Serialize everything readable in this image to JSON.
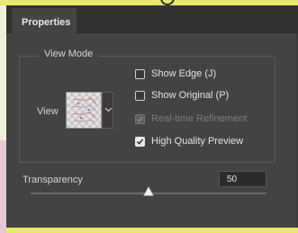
{
  "panel": {
    "tab_label": "Properties"
  },
  "view_mode": {
    "group_title": "View Mode",
    "view_label": "View",
    "options": [
      {
        "label": "Show Edge (J)",
        "checked": false,
        "disabled": false
      },
      {
        "label": "Show Original (P)",
        "checked": false,
        "disabled": false
      },
      {
        "label": "Real-time Refinement",
        "checked": true,
        "disabled": true
      },
      {
        "label": "High Quality Preview",
        "checked": true,
        "disabled": false
      }
    ]
  },
  "transparency": {
    "label": "Transparency",
    "value": "50",
    "slider_fraction": 0.5
  },
  "icons": {
    "dropdown": "chevron-down-icon",
    "thumbnail": "view-mode-thumbnail",
    "slider": "slider-handle-icon"
  },
  "colors": {
    "panel_bg": "#434343",
    "tab_bar_bg": "#323232",
    "field_bg": "#2b2b2b",
    "text": "#e2e2e2",
    "disabled_text": "#7d7d7d"
  }
}
